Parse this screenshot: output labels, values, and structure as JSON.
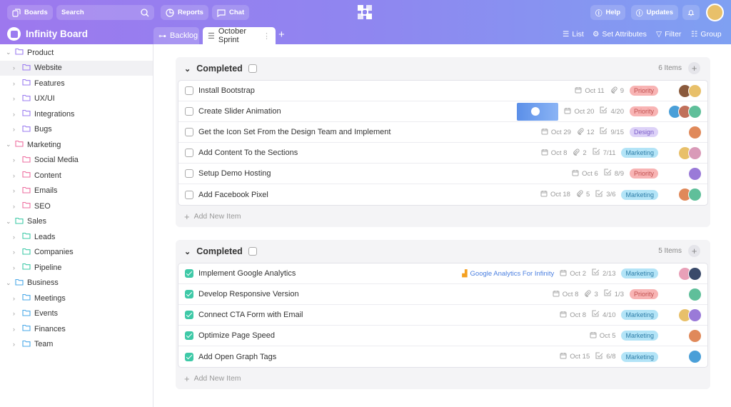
{
  "topbar": {
    "boards": "Boards",
    "search_placeholder": "Search",
    "reports": "Reports",
    "chat": "Chat",
    "help": "Help",
    "updates": "Updates"
  },
  "board": {
    "title": "Infinity Board",
    "tabs": [
      {
        "label": "Backlog"
      },
      {
        "label": "October Sprint"
      }
    ],
    "actions": {
      "list": "List",
      "set_attributes": "Set Attributes",
      "filter": "Filter",
      "group": "Group"
    }
  },
  "sidebar": {
    "folders": [
      {
        "label": "Product",
        "color": "#9b7cf0",
        "children": [
          "Website",
          "Features",
          "UX/UI",
          "Integrations",
          "Bugs"
        ]
      },
      {
        "label": "Marketing",
        "color": "#ee6fa0",
        "children": [
          "Social Media",
          "Content",
          "Emails",
          "SEO"
        ]
      },
      {
        "label": "Sales",
        "color": "#3ec9a7",
        "children": [
          "Leads",
          "Companies",
          "Pipeline"
        ]
      },
      {
        "label": "Business",
        "color": "#4aa8e8",
        "children": [
          "Meetings",
          "Events",
          "Finances",
          "Team"
        ]
      }
    ],
    "selected": "Website"
  },
  "tag_colors": {
    "Priority": [
      "#f8b4b4",
      "#c0504f"
    ],
    "Design": [
      "#ddd2f8",
      "#7a5cc8"
    ],
    "Marketing": [
      "#b3e4f7",
      "#2f7ea8"
    ]
  },
  "groups": [
    {
      "title": "Completed",
      "count": "6 Items",
      "add_label": "Add New Item",
      "items": [
        {
          "title": "Install Bootstrap",
          "done": false,
          "date": "Oct 11",
          "attachments": "9",
          "tag": "Priority",
          "avatars": [
            "#8a5a3c",
            "#e8c06a"
          ]
        },
        {
          "title": "Create Slider Animation",
          "done": false,
          "thumbnail": true,
          "date": "Oct 20",
          "checklist": "4/20",
          "tag": "Priority",
          "avatars": [
            "#4a9fd8",
            "#c0705a",
            "#5fbf9a"
          ]
        },
        {
          "title": "Get the Icon Set From the Design Team and Implement",
          "done": false,
          "date": "Oct 29",
          "attachments": "12",
          "checklist": "9/15",
          "tag": "Design",
          "avatars": [
            "#e0895a"
          ]
        },
        {
          "title": "Add Content To the Sections",
          "done": false,
          "date": "Oct 8",
          "attachments": "2",
          "checklist": "7/11",
          "tag": "Marketing",
          "avatars": [
            "#e8c06a",
            "#d99ab8"
          ]
        },
        {
          "title": "Setup Demo Hosting",
          "done": false,
          "date": "Oct 6",
          "checklist": "8/9",
          "tag": "Priority",
          "avatars": [
            "#9a7ad8"
          ]
        },
        {
          "title": "Add Facebook Pixel",
          "done": false,
          "date": "Oct 18",
          "attachments": "5",
          "checklist": "3/6",
          "tag": "Marketing",
          "avatars": [
            "#e0895a",
            "#5fbf9a"
          ]
        }
      ]
    },
    {
      "title": "Completed",
      "count": "5 Items",
      "add_label": "Add New Item",
      "items": [
        {
          "title": "Implement Google Analytics",
          "done": true,
          "link": "Google Analytics For Infinity",
          "date": "Oct 2",
          "checklist": "2/13",
          "tag": "Marketing",
          "avatars": [
            "#e8a0b8",
            "#3a4a6a"
          ]
        },
        {
          "title": "Develop Responsive Version",
          "done": true,
          "date": "Oct 8",
          "attachments": "3",
          "checklist": "1/3",
          "tag": "Priority",
          "avatars": [
            "#5fbf9a"
          ]
        },
        {
          "title": "Connect CTA Form with Email",
          "done": true,
          "date": "Oct 8",
          "checklist": "4/10",
          "tag": "Marketing",
          "avatars": [
            "#e8c06a",
            "#9a7ad8"
          ]
        },
        {
          "title": "Optimize Page Speed",
          "done": true,
          "date": "Oct 5",
          "tag": "Marketing",
          "avatars": [
            "#e0895a"
          ]
        },
        {
          "title": "Add Open Graph Tags",
          "done": true,
          "date": "Oct 15",
          "checklist": "6/8",
          "tag": "Marketing",
          "avatars": [
            "#4a9fd8"
          ]
        }
      ]
    }
  ]
}
